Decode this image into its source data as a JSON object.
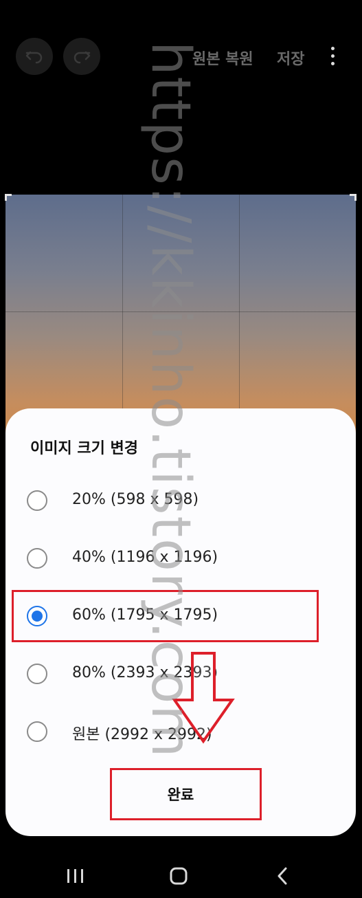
{
  "toolbar": {
    "undo_icon": "undo-icon",
    "redo_icon": "redo-icon",
    "restore_label": "원본 복원",
    "save_label": "저장",
    "more_icon": "more-vertical-icon"
  },
  "dialog": {
    "title": "이미지 크기 변경",
    "options": [
      {
        "label": "20% (598 x 598)",
        "selected": false
      },
      {
        "label": "40% (1196 x 1196)",
        "selected": false
      },
      {
        "label": "60% (1795 x 1795)",
        "selected": true
      },
      {
        "label": "80% (2393 x 2393)",
        "selected": false
      },
      {
        "label": "원본 (2992 x 2992)",
        "selected": false
      }
    ],
    "done_label": "완료"
  },
  "watermark": "https://kkinho.tistory.com",
  "navbar": {
    "recents_icon": "recent-apps-icon",
    "home_icon": "home-icon",
    "back_icon": "back-icon"
  },
  "colors": {
    "accent": "#1e74e8",
    "highlight": "#dd1f2a"
  }
}
